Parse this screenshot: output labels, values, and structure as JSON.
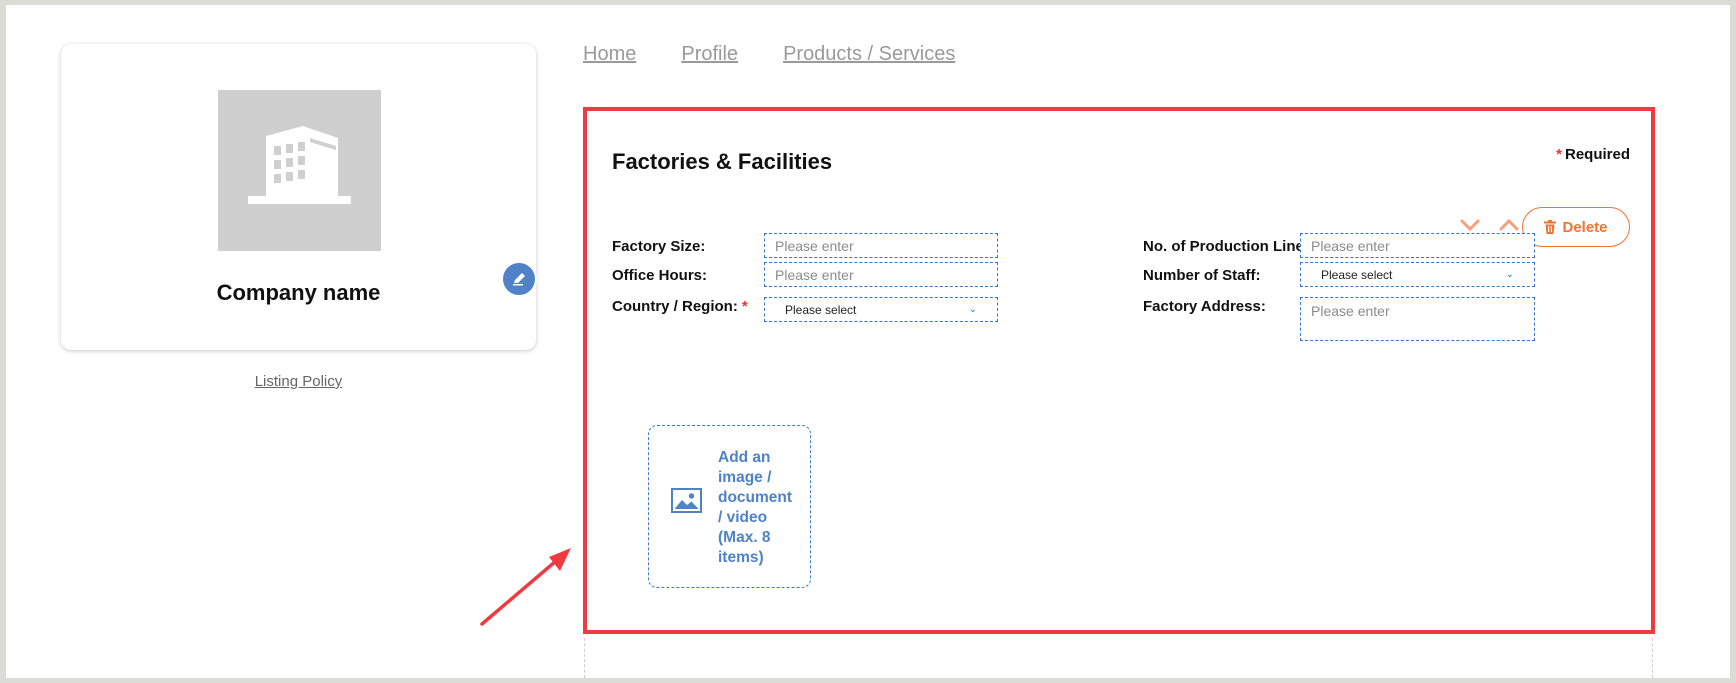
{
  "nav": {
    "links": [
      "Home",
      "Profile",
      "Products / Services"
    ]
  },
  "profile": {
    "company_name": "Company name",
    "listing_policy": "Listing Policy"
  },
  "section": {
    "title": "Factories & Facilities",
    "required_star": "*",
    "required_label": "Required",
    "delete_label": "Delete"
  },
  "fields": {
    "factory_size": {
      "label": "Factory Size:",
      "placeholder": "Please enter"
    },
    "office_hours": {
      "label": "Office Hours:",
      "placeholder": "Please enter"
    },
    "country_region": {
      "label": "Country / Region:",
      "required_star": "*",
      "value": "Please select"
    },
    "production_lines": {
      "label": "No. of Production Line:",
      "placeholder": "Please enter"
    },
    "number_of_staff": {
      "label": "Number of Staff:",
      "value": "Please select"
    },
    "factory_address": {
      "label": "Factory Address:",
      "placeholder": "Please enter"
    }
  },
  "upload": {
    "label": "Add an image / document / video (Max. 8 items)"
  },
  "icons": {
    "building": "building-icon",
    "pencil": "pencil-icon",
    "move_down": "chevron-down-icon",
    "move_up": "chevron-up-icon",
    "trash": "trash-icon",
    "image": "image-icon",
    "select_caret": "chevron-down-icon"
  },
  "colors": {
    "highlight_border": "#ef3b40",
    "accent_orange": "#f07234",
    "accent_blue": "#4f82c8",
    "field_border": "#3672d6",
    "required_star": "#e33333"
  }
}
